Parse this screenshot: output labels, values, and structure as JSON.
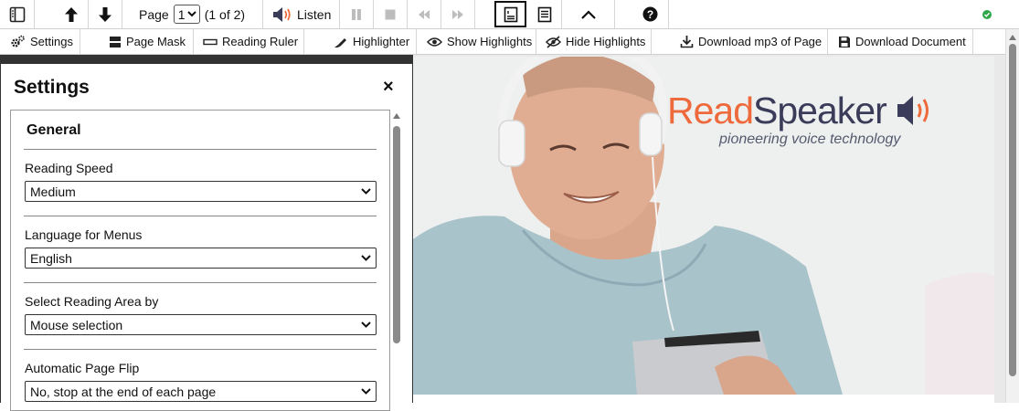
{
  "toolbar": {
    "page_label": "Page",
    "page_value": "1",
    "page_count": "(1 of 2)",
    "listen_label": "Listen"
  },
  "toolbar2": {
    "settings": "Settings",
    "page_mask": "Page Mask",
    "reading_ruler": "Reading Ruler",
    "highlighter": "Highlighter",
    "show_highlights": "Show Highlights",
    "hide_highlights": "Hide Highlights",
    "download_mp3": "Download mp3 of Page",
    "download_document": "Download Document"
  },
  "settings_panel": {
    "title": "Settings",
    "close": "×",
    "section": "General",
    "fields": [
      {
        "label": "Reading Speed",
        "value": "Medium"
      },
      {
        "label": "Language for Menus",
        "value": "English"
      },
      {
        "label": "Select Reading Area by",
        "value": "Mouse selection"
      },
      {
        "label": "Automatic Page Flip",
        "value": "No, stop at the end of each page"
      }
    ]
  },
  "document": {
    "logo_read": "Read",
    "logo_speaker": "Speaker",
    "tagline": "pioneering voice technology"
  },
  "colors": {
    "brand_orange": "#ee6a3c",
    "brand_navy": "#3b3b5a",
    "status_green": "#2ea64a"
  }
}
